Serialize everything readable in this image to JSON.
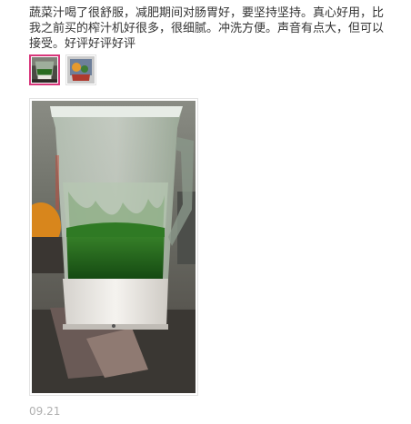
{
  "review": {
    "text": "蔬菜汁喝了很舒服，减肥期间对肠胃好，要坚持坚持。真心好用，比我之前买的榨汁机好很多，很细腻。冲洗方便。声音有点大，但可以接受。好评好评好评",
    "date": "09.21",
    "thumbnails": [
      {
        "icon": "juicer-photo-thumbnail",
        "selected": true
      },
      {
        "icon": "fruit-photo-thumbnail",
        "selected": false
      }
    ],
    "main_photo": {
      "icon": "blender-green-juice-photo"
    },
    "colors": {
      "text": "#333333",
      "date": "#b0b0b0",
      "thumb_active_border": "#d8367a",
      "juice_green": "#1f5a1a"
    }
  }
}
